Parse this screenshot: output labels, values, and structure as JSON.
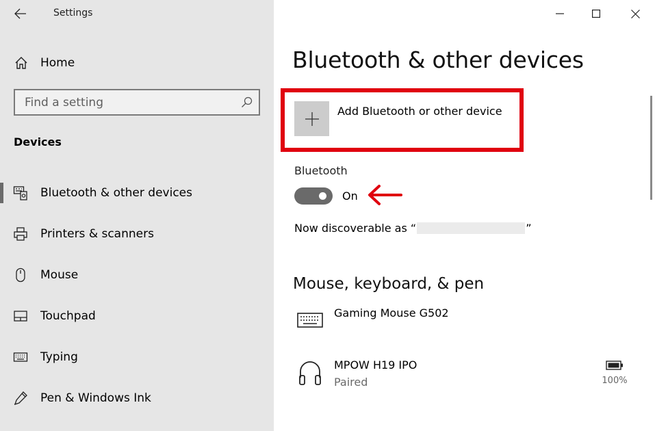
{
  "window": {
    "title": "Settings",
    "controls": [
      "minimize",
      "maximize",
      "close"
    ]
  },
  "sidebar": {
    "home_label": "Home",
    "search": {
      "placeholder": "Find a setting",
      "value": ""
    },
    "section_title": "Devices",
    "items": [
      {
        "label": "Bluetooth & other devices",
        "icon": "bluetooth-devices-icon",
        "active": true
      },
      {
        "label": "Printers & scanners",
        "icon": "printer-icon",
        "active": false
      },
      {
        "label": "Mouse",
        "icon": "mouse-icon",
        "active": false
      },
      {
        "label": "Touchpad",
        "icon": "touchpad-icon",
        "active": false
      },
      {
        "label": "Typing",
        "icon": "keyboard-icon",
        "active": false
      },
      {
        "label": "Pen & Windows Ink",
        "icon": "pen-icon",
        "active": false
      }
    ]
  },
  "main": {
    "page_title": "Bluetooth & other devices",
    "add_device_label": "Add Bluetooth or other device",
    "bluetooth": {
      "label": "Bluetooth",
      "state": "On",
      "enabled": true
    },
    "discoverable_prefix": "Now discoverable as “",
    "discoverable_suffix": "”",
    "section_title": "Mouse, keyboard, & pen",
    "devices": [
      {
        "name": "Gaming Mouse G502",
        "status": "",
        "icon": "keyboard-icon"
      },
      {
        "name": "MPOW H19 IPO",
        "status": "Paired",
        "icon": "headphones-icon",
        "battery": "100%"
      }
    ]
  },
  "colors": {
    "sidebar_bg": "#e6e6e6",
    "highlight_red": "#e0000f",
    "toggle_on": "#6a6a6a"
  }
}
